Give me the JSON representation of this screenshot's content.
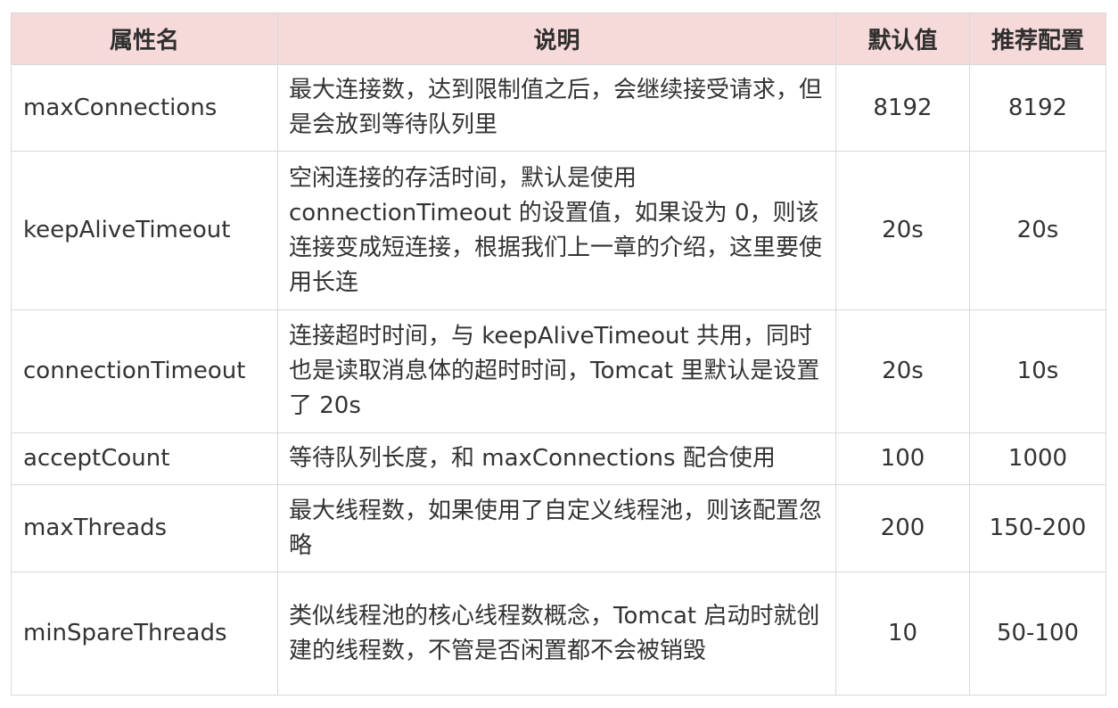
{
  "table": {
    "headers": [
      "属性名",
      "说明",
      "默认值",
      "推荐配置"
    ],
    "rows": [
      {
        "name": "maxConnections",
        "description": "最大连接数，达到限制值之后，会继续接受请求，但是会放到等待队列里",
        "default": "8192",
        "recommended": "8192"
      },
      {
        "name": "keepAliveTimeout",
        "description": "空闲连接的存活时间，默认是使用 connectionTimeout 的设置值，如果设为 0，则该连接变成短连接，根据我们上一章的介绍，这里要使用长连",
        "default": "20s",
        "recommended": "20s"
      },
      {
        "name": "connectionTimeout",
        "description": "连接超时时间，与 keepAliveTimeout 共用，同时也是读取消息体的超时时间，Tomcat 里默认是设置了 20s",
        "default": "20s",
        "recommended": "10s"
      },
      {
        "name": "acceptCount",
        "description": "等待队列长度，和 maxConnections 配合使用",
        "default": "100",
        "recommended": "1000"
      },
      {
        "name": "maxThreads",
        "description": "最大线程数，如果使用了自定义线程池，则该配置忽略",
        "default": "200",
        "recommended": "150-200"
      },
      {
        "name": "minSpareThreads",
        "description": "类似线程池的核心线程数概念，Tomcat 启动时就创建的线程数，不管是否闲置都不会被销毁",
        "default": "10",
        "recommended": "50-100"
      }
    ]
  },
  "colors": {
    "header_background": "#f6d9d9",
    "border": "#d9d9d9",
    "text": "#333333"
  }
}
